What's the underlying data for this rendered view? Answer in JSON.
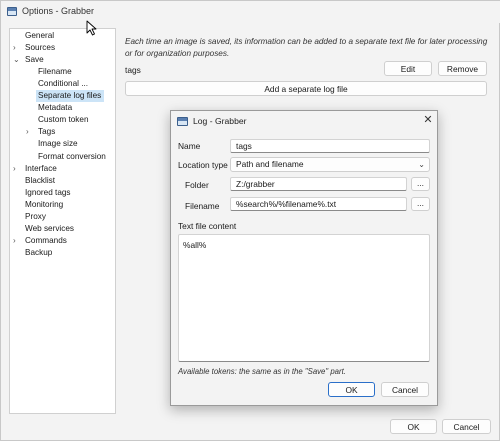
{
  "window": {
    "title": "Options - Grabber"
  },
  "tree": [
    {
      "label": "General",
      "level": 0,
      "arrow": "",
      "selected": false
    },
    {
      "label": "Sources",
      "level": 0,
      "arrow": "›",
      "selected": false
    },
    {
      "label": "Save",
      "level": 0,
      "arrow": "⌄",
      "selected": false
    },
    {
      "label": "Filename",
      "level": 1,
      "arrow": "",
      "selected": false
    },
    {
      "label": "Conditional ...",
      "level": 1,
      "arrow": "",
      "selected": false
    },
    {
      "label": "Separate log files",
      "level": 1,
      "arrow": "",
      "selected": true
    },
    {
      "label": "Metadata",
      "level": 1,
      "arrow": "",
      "selected": false
    },
    {
      "label": "Custom token",
      "level": 1,
      "arrow": "",
      "selected": false
    },
    {
      "label": "Tags",
      "level": 1,
      "arrow": "›",
      "selected": false
    },
    {
      "label": "Image size",
      "level": 1,
      "arrow": "",
      "selected": false
    },
    {
      "label": "Format conversion",
      "level": 1,
      "arrow": "",
      "selected": false
    },
    {
      "label": "Interface",
      "level": 0,
      "arrow": "›",
      "selected": false
    },
    {
      "label": "Blacklist",
      "level": 0,
      "arrow": "",
      "selected": false
    },
    {
      "label": "Ignored tags",
      "level": 0,
      "arrow": "",
      "selected": false
    },
    {
      "label": "Monitoring",
      "level": 0,
      "arrow": "",
      "selected": false
    },
    {
      "label": "Proxy",
      "level": 0,
      "arrow": "",
      "selected": false
    },
    {
      "label": "Web services",
      "level": 0,
      "arrow": "",
      "selected": false
    },
    {
      "label": "Commands",
      "level": 0,
      "arrow": "›",
      "selected": false
    },
    {
      "label": "Backup",
      "level": 0,
      "arrow": "",
      "selected": false
    }
  ],
  "main": {
    "description": "Each time an image is saved, its information can be added to a separate text file for later processing or for organization purposes.",
    "log_entry": "tags",
    "edit_label": "Edit",
    "remove_label": "Remove",
    "add_label": "Add a separate log file"
  },
  "footer": {
    "ok_label": "OK",
    "cancel_label": "Cancel"
  },
  "dialog": {
    "title": "Log - Grabber",
    "close_icon": "✕",
    "name_label": "Name",
    "name_value": "tags",
    "location_label": "Location type",
    "location_value": "Path and filename",
    "folder_label": "Folder",
    "folder_value": "Z:/grabber",
    "browse_label": "...",
    "filename_label": "Filename",
    "filename_value": "%search%/%filename%.txt",
    "content_label": "Text file content",
    "content_value": "%all%",
    "hint": "Available tokens: the same as in the \"Save\" part.",
    "ok_label": "OK",
    "cancel_label": "Cancel"
  }
}
